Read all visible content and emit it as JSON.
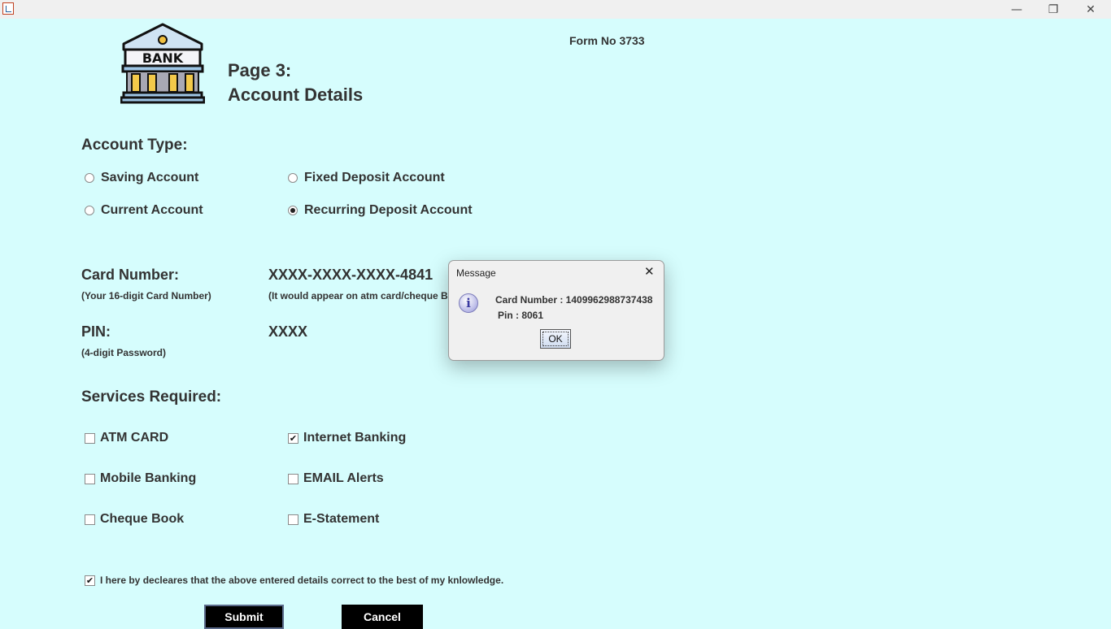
{
  "window": {
    "minimize_icon": "—",
    "maximize_icon": "❐",
    "close_icon": "✕"
  },
  "form_no": "Form No 3733",
  "logo_text": "BANK",
  "page": {
    "line1": "Page 3:",
    "line2": "Account Details"
  },
  "account_type": {
    "heading": "Account Type:",
    "options": [
      "Saving Account",
      "Fixed Deposit Account",
      "Current Account",
      "Recurring Deposit Account"
    ],
    "selected": "Recurring Deposit Account"
  },
  "card": {
    "label": "Card Number:",
    "hint": "(Your 16-digit Card Number)",
    "value": "XXXX-XXXX-XXXX-4841",
    "note": "(It would appear on atm card/cheque Bo"
  },
  "pin": {
    "label": "PIN:",
    "hint": "(4-digit Password)",
    "value": "XXXX"
  },
  "services": {
    "heading": "Services Required:",
    "items": [
      {
        "label": "ATM CARD",
        "checked": false
      },
      {
        "label": "Internet Banking",
        "checked": true
      },
      {
        "label": "Mobile Banking",
        "checked": false
      },
      {
        "label": "EMAIL Alerts",
        "checked": false
      },
      {
        "label": "Cheque Book",
        "checked": false
      },
      {
        "label": "E-Statement",
        "checked": false
      }
    ]
  },
  "declaration": {
    "label": "I here by decleares that the above entered details correct to the best of my knlowledge.",
    "checked": true
  },
  "buttons": {
    "submit": "Submit",
    "cancel": "Cancel"
  },
  "dialog": {
    "title": "Message",
    "close_icon": "✕",
    "info_icon": "i",
    "line1": "Card Number : 1409962988737438",
    "line2": "Pin : 8061",
    "ok": "OK"
  },
  "check_mark": "✔",
  "colors": {
    "background": "#d6fdfd",
    "titlebar": "#f0f0f0",
    "button": "#000000",
    "text": "#333333"
  }
}
